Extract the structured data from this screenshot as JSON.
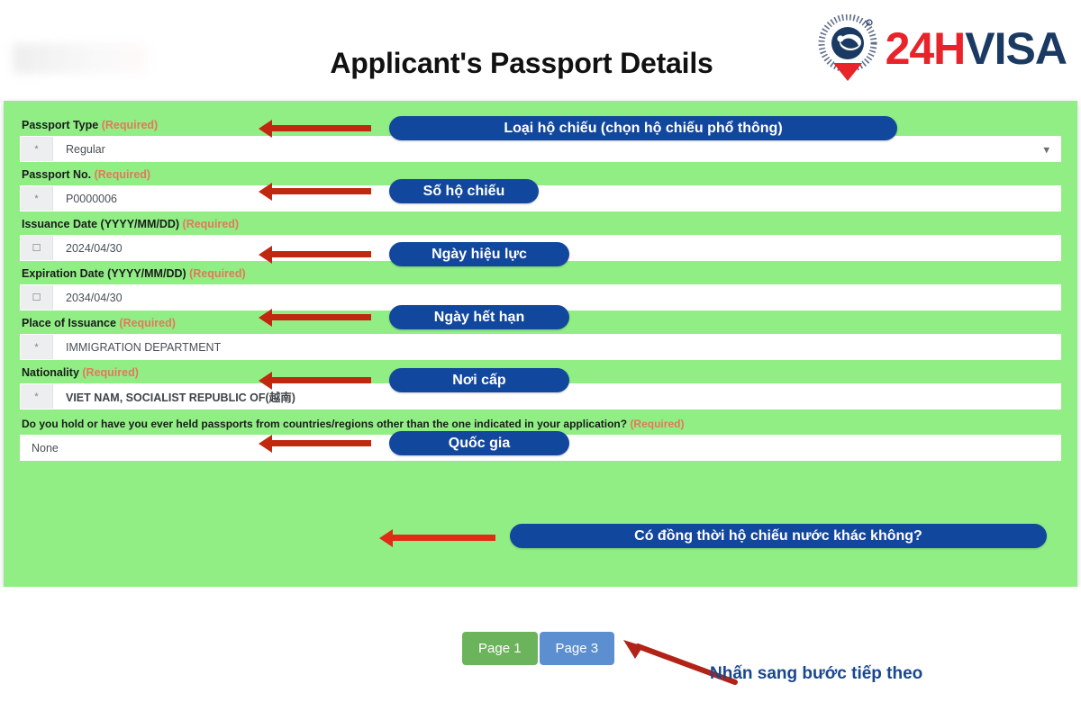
{
  "header": {
    "title": "Applicant's Passport Details",
    "watermark": "",
    "brand": {
      "prefix": "24H",
      "suffix": "VISA",
      "mark_icon": "globe-pin-icon"
    }
  },
  "form": {
    "required_tag": "(Required)",
    "fields": [
      {
        "label": "Passport Type",
        "required_tag": "(Required)",
        "prefix_icon": "asterisk-icon",
        "value": "Regular",
        "control": "select",
        "dropdown_icon": "chevron-down-icon",
        "callout": "Loại hộ chiếu (chọn hộ chiếu phổ thông)"
      },
      {
        "label": "Passport No.",
        "required_tag": "(Required)",
        "prefix_icon": "asterisk-icon",
        "value": "P0000006",
        "control": "text",
        "callout": "Số hộ chiếu"
      },
      {
        "label": "Issuance Date (YYYY/MM/DD)",
        "required_tag": "(Required)",
        "prefix_icon": "calendar-icon",
        "value": "2024/04/30",
        "control": "date",
        "callout": "Ngày hiệu lực"
      },
      {
        "label": "Expiration Date (YYYY/MM/DD)",
        "required_tag": "(Required)",
        "prefix_icon": "calendar-icon",
        "value": "2034/04/30",
        "control": "date",
        "callout": "Ngày hết hạn"
      },
      {
        "label": "Place of Issuance",
        "required_tag": "(Required)",
        "prefix_icon": "asterisk-icon",
        "value": "IMMIGRATION DEPARTMENT",
        "control": "text",
        "callout": "Nơi cấp"
      },
      {
        "label": "Nationality",
        "required_tag": "(Required)",
        "prefix_icon": "asterisk-icon",
        "value": "VIET NAM, SOCIALIST REPUBLIC OF(越南)",
        "control": "text",
        "callout": "Quốc gia"
      }
    ],
    "question": {
      "label": "Do you hold or have you ever held passports from countries/regions other than the one indicated in your application?",
      "required_tag": "(Required)",
      "value": "None",
      "callout": "Có đồng thời hộ chiếu nước khác không?"
    }
  },
  "footer": {
    "page_prev": "Page 1",
    "page_next": "Page 3",
    "note": "Nhấn sang bước tiếp theo"
  },
  "colors": {
    "card_green": "#90EE85",
    "pill_blue": "#12479E",
    "arrow_red": "#C0280F",
    "brand_red": "#E8232A",
    "brand_navy": "#1B3A63",
    "required_orange": "#E2795B",
    "page_prev_green": "#6CB45C",
    "page_next_blue": "#5B8FD0",
    "note_blue": "#17478F"
  }
}
